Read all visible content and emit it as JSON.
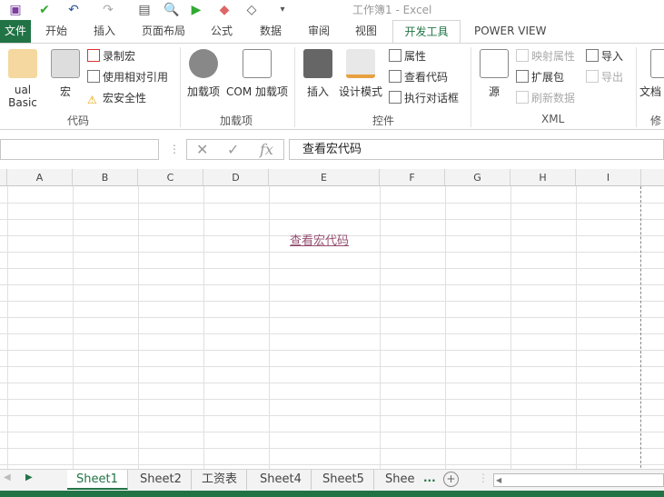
{
  "window": {
    "title": "工作簿1 - Excel"
  },
  "qat": {
    "icons": [
      "save-icon",
      "touch-mode-icon",
      "undo-icon",
      "redo-icon",
      "form-icon",
      "print-preview-icon",
      "macro-play-icon",
      "eraser-icon",
      "fill-color-icon",
      "customize-icon"
    ]
  },
  "tabs": [
    "文件",
    "开始",
    "插入",
    "页面布局",
    "公式",
    "数据",
    "审阅",
    "视图",
    "开发工具",
    "POWER VIEW"
  ],
  "active_tab": "开发工具",
  "ribbon": {
    "code": {
      "label": "代码",
      "vb": "ual Basic",
      "macro": "宏",
      "record": "录制宏",
      "relative": "使用相对引用",
      "security": "宏安全性"
    },
    "addins": {
      "label": "加载项",
      "addins": "加载项",
      "com": "COM 加载项"
    },
    "controls": {
      "label": "控件",
      "insert": "插入",
      "design": "设计模式",
      "properties": "属性",
      "view_code": "查看代码",
      "dialog": "执行对话框"
    },
    "xml": {
      "label": "XML",
      "source": "源",
      "map_props": "映射属性",
      "expand": "扩展包",
      "refresh": "刷新数据",
      "import": "导入",
      "export": "导出"
    },
    "modify": {
      "label": "修",
      "doc": "文档"
    }
  },
  "formula_bar": {
    "name_box": "",
    "content": "查看宏代码",
    "fx": "fx"
  },
  "columns": [
    "A",
    "B",
    "C",
    "D",
    "E",
    "F",
    "G",
    "H",
    "I"
  ],
  "cell_link": "查看宏代码",
  "sheets": [
    "Sheet1",
    "Sheet2",
    "工资表",
    "Sheet4",
    "Sheet5",
    "Shee"
  ],
  "active_sheet": "Sheet1",
  "more": "..."
}
